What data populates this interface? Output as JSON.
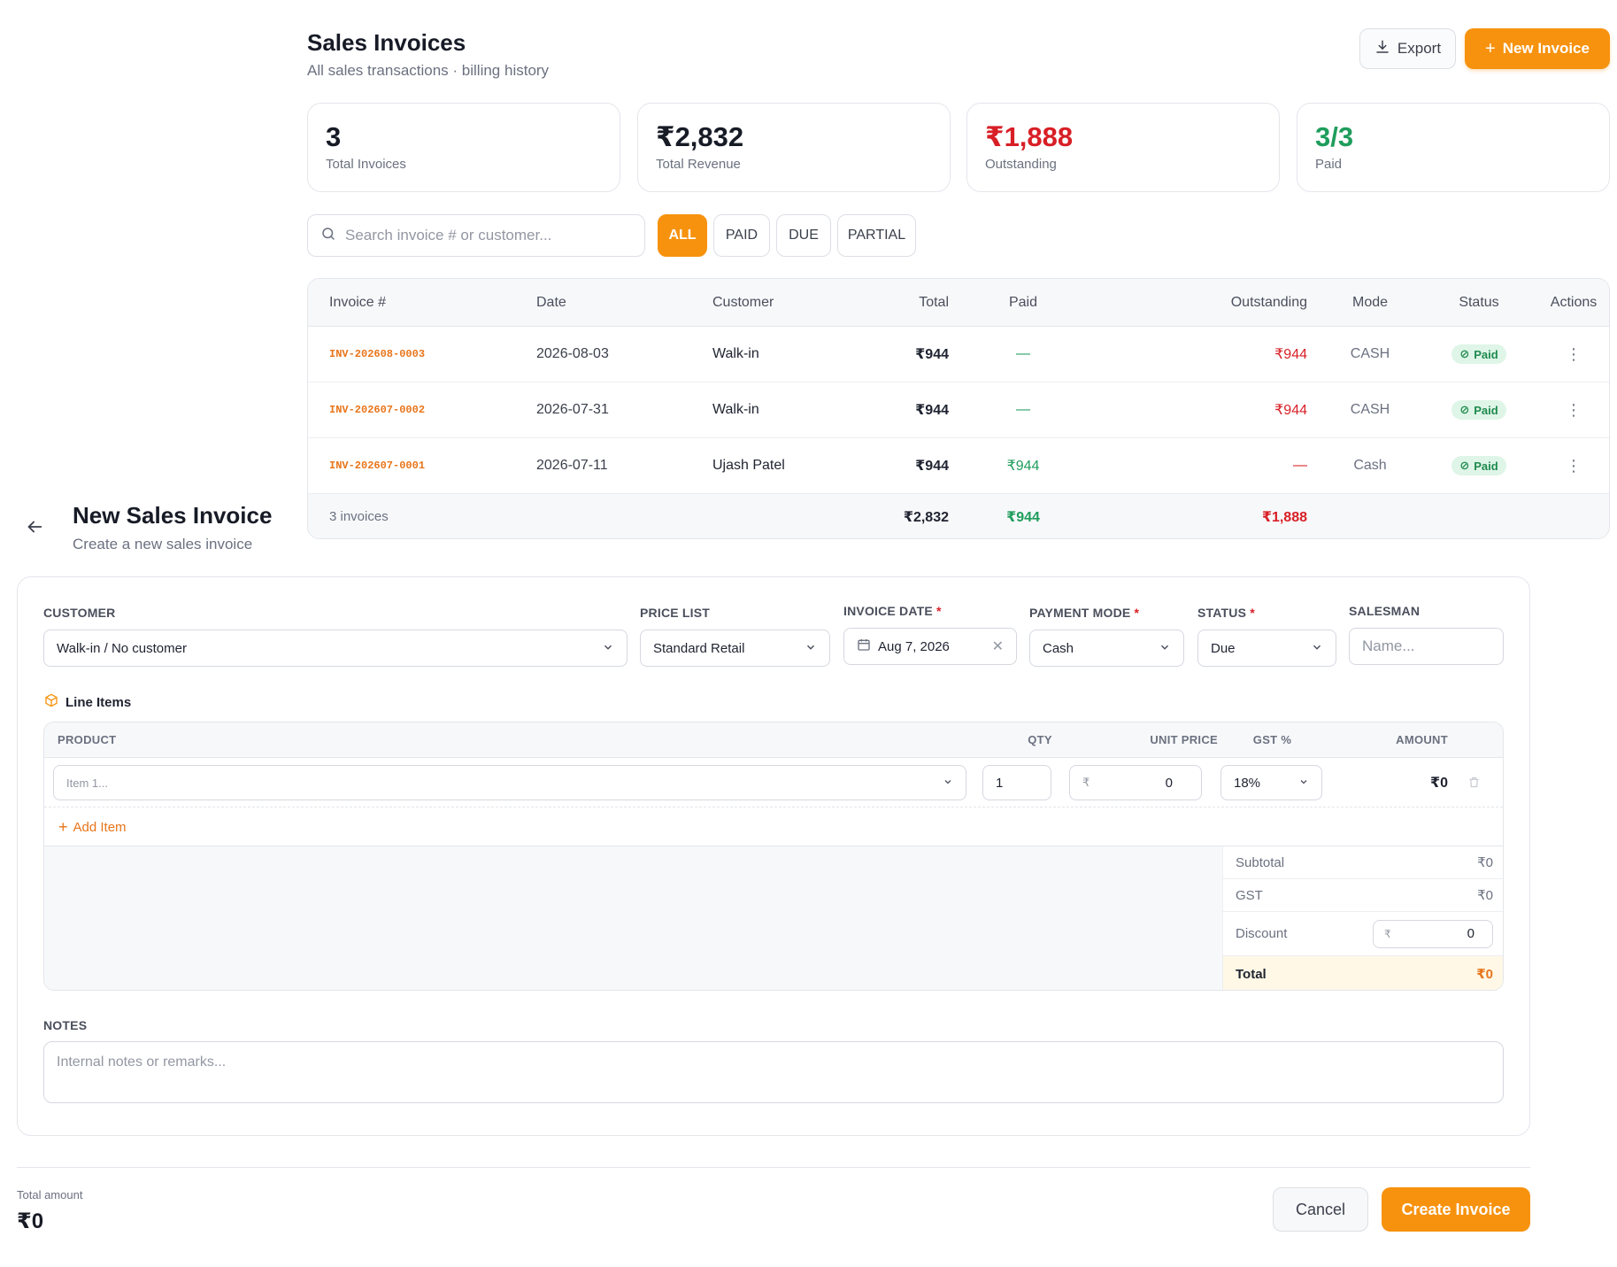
{
  "header": {
    "title": "Sales Invoices",
    "subtitle": "All sales transactions · billing history",
    "export_label": "Export",
    "new_invoice_label": "New Invoice"
  },
  "stats": [
    {
      "value": "3",
      "label": "Total Invoices",
      "color": "#171b26"
    },
    {
      "value": "₹2,832",
      "label": "Total Revenue",
      "color": "#171b26"
    },
    {
      "value": "₹1,888",
      "label": "Outstanding",
      "color": "#d81f26"
    },
    {
      "value": "3/3",
      "label": "Paid",
      "color": "#1f9d5c"
    }
  ],
  "search": {
    "placeholder": "Search invoice # or customer..."
  },
  "filters": [
    "ALL",
    "PAID",
    "DUE",
    "PARTIAL"
  ],
  "table": {
    "columns": [
      "Invoice #",
      "Date",
      "Customer",
      "Total",
      "Paid",
      "Outstanding",
      "Mode",
      "Status",
      "Actions"
    ],
    "rows": [
      {
        "invoice": "INV-202608-0003",
        "date": "2026-08-03",
        "customer": "Walk-in",
        "total": "₹944",
        "paid": "—",
        "outstanding": "₹944",
        "mode": "CASH",
        "status": "Paid"
      },
      {
        "invoice": "INV-202607-0002",
        "date": "2026-07-31",
        "customer": "Walk-in",
        "total": "₹944",
        "paid": "—",
        "outstanding": "₹944",
        "mode": "CASH",
        "status": "Paid"
      },
      {
        "invoice": "INV-202607-0001",
        "date": "2026-07-11",
        "customer": "Ujash Patel",
        "total": "₹944",
        "paid": "₹944",
        "outstanding": "—",
        "mode": "Cash",
        "status": "Paid"
      }
    ],
    "footer": {
      "count": "3 invoices",
      "total": "₹2,832",
      "paid": "₹944",
      "outstanding": "₹1,888"
    }
  },
  "new_invoice": {
    "title": "New Sales Invoice",
    "subtitle": "Create a new sales invoice",
    "fields": {
      "customer": {
        "label": "CUSTOMER",
        "value": "Walk-in / No customer"
      },
      "price_list": {
        "label": "PRICE LIST",
        "value": "Standard Retail"
      },
      "invoice_date": {
        "label": "INVOICE DATE",
        "value": "Aug 7, 2026"
      },
      "payment_mode": {
        "label": "PAYMENT MODE",
        "value": "Cash"
      },
      "status": {
        "label": "STATUS",
        "value": "Due"
      },
      "salesman": {
        "label": "SALESMAN",
        "placeholder": "Name..."
      }
    },
    "line_items": {
      "title": "Line Items",
      "columns": [
        "PRODUCT",
        "QTY",
        "UNIT PRICE",
        "GST %",
        "AMOUNT"
      ],
      "row": {
        "product_placeholder": "Item 1...",
        "qty": "1",
        "currency": "₹",
        "unit_price": "0",
        "gst": "18%",
        "amount": "₹0"
      },
      "add_item_label": "Add Item"
    },
    "totals": {
      "subtotal_label": "Subtotal",
      "subtotal": "₹0",
      "gst_label": "GST",
      "gst": "₹0",
      "discount_label": "Discount",
      "discount_currency": "₹",
      "discount": "0",
      "total_label": "Total",
      "total": "₹0"
    },
    "notes": {
      "label": "NOTES",
      "placeholder": "Internal notes or remarks..."
    },
    "footer": {
      "total_amount_label": "Total amount",
      "total_amount": "₹0",
      "cancel_label": "Cancel",
      "create_label": "Create Invoice"
    }
  }
}
